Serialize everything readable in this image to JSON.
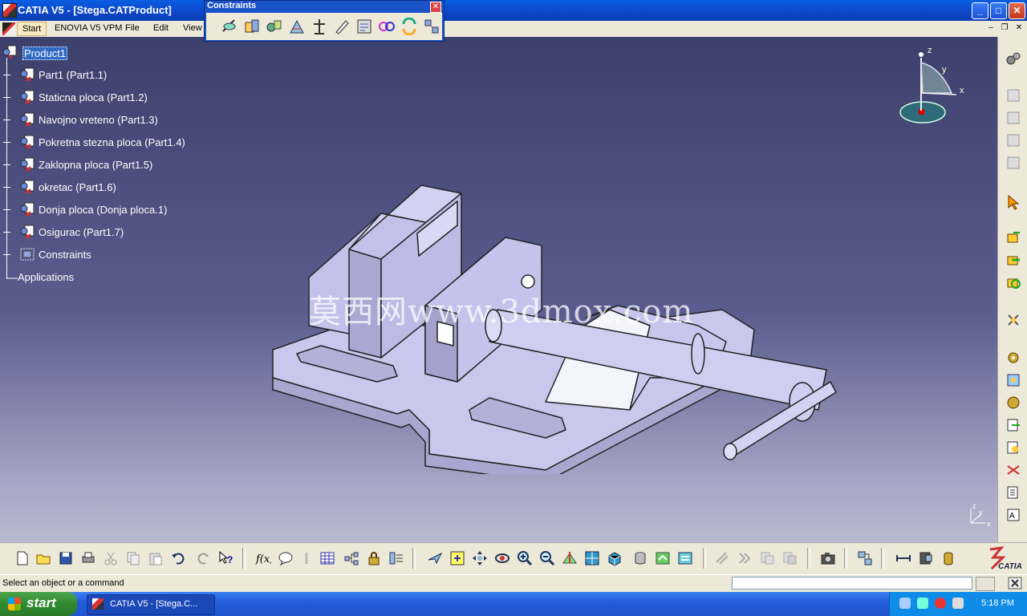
{
  "window": {
    "title": "CATIA V5 - [Stega.CATProduct]",
    "buttons": {
      "minimize": "_",
      "maximize": "□",
      "close": "✕"
    }
  },
  "menubar": {
    "items": [
      "Start",
      "ENOVIA V5 VPM",
      "File",
      "Edit",
      "View"
    ],
    "mdi": {
      "minimize": "–",
      "restore": "❐",
      "close": "✕"
    }
  },
  "constraints_toolbar": {
    "title": "Constraints",
    "close": "✕",
    "icons": [
      "coincidence-constraint-icon",
      "contact-constraint-icon",
      "offset-constraint-icon",
      "angle-constraint-icon",
      "fix-component-icon",
      "fix-together-icon",
      "quick-constraint-icon",
      "flexible-rigid-icon",
      "change-constraint-icon",
      "reuse-pattern-icon"
    ]
  },
  "tree": {
    "items": [
      {
        "label": "Product1",
        "selected": true,
        "icon": "product-icon"
      },
      {
        "label": "Part1 (Part1.1)",
        "icon": "part-icon"
      },
      {
        "label": "Staticna ploca (Part1.2)",
        "icon": "part-icon"
      },
      {
        "label": "Navojno vreteno (Part1.3)",
        "icon": "part-icon"
      },
      {
        "label": "Pokretna stezna ploca (Part1.4)",
        "icon": "part-icon"
      },
      {
        "label": "Zaklopna ploca (Part1.5)",
        "icon": "part-icon"
      },
      {
        "label": "okretac (Part1.6)",
        "icon": "part-icon"
      },
      {
        "label": "Donja ploca (Donja ploca.1)",
        "icon": "part-icon"
      },
      {
        "label": "Osigurac (Part1.7)",
        "icon": "part-icon"
      },
      {
        "label": "Constraints",
        "icon": "constraints-icon"
      },
      {
        "label": "Applications",
        "icon": "none"
      }
    ]
  },
  "compass": {
    "x": "x",
    "y": "y",
    "z": "z"
  },
  "axis_triad": {
    "x": "x",
    "y": "y",
    "z": "z"
  },
  "watermark": "莫西网www.3dmox.com",
  "status": {
    "message": "Select an object or a command",
    "command_input": ""
  },
  "taskbar": {
    "start_label": "start",
    "task_item": "CATIA V5 - [Stega.C...",
    "clock": "5:18 PM"
  },
  "colors": {
    "title_bar": "#0d46c8",
    "viewport_top": "#3d3f6c",
    "viewport_bottom": "#b9b9cf",
    "model_face": "#c8c6ea",
    "selection": "#316ac5"
  }
}
